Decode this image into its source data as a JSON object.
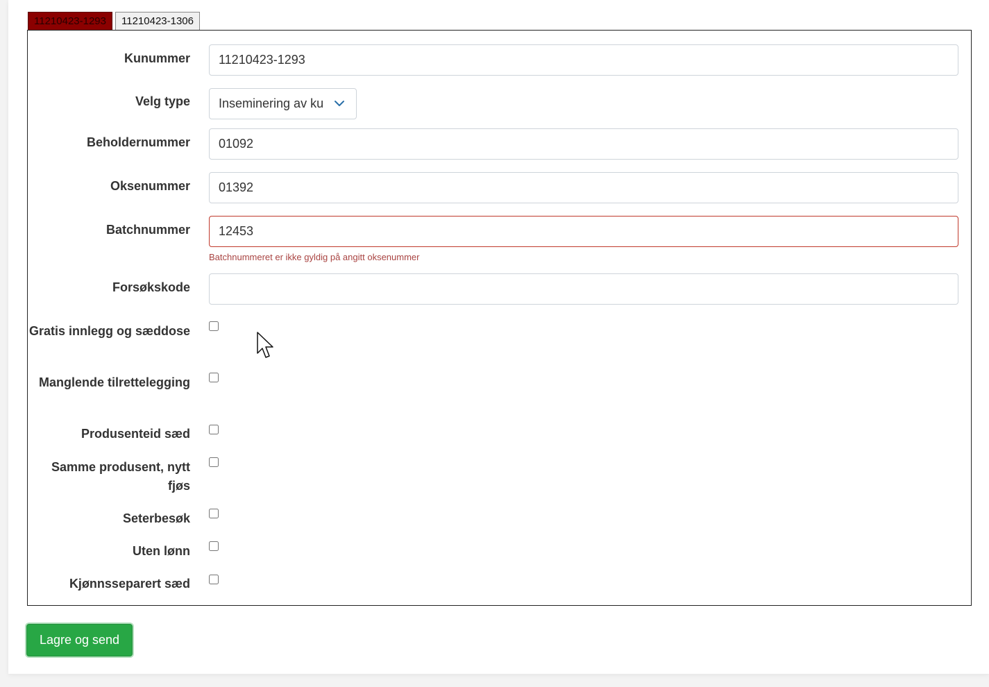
{
  "tabs": [
    {
      "label": "11210423-1293",
      "active": true
    },
    {
      "label": "11210423-1306",
      "active": false
    }
  ],
  "form": {
    "kunummer": {
      "label": "Kunummer",
      "value": "11210423-1293"
    },
    "type": {
      "label": "Velg type",
      "value": "Inseminering av ku",
      "icon": "chevron-down-icon"
    },
    "beholdernummer": {
      "label": "Beholdernummer",
      "value": "01092"
    },
    "oksenummer": {
      "label": "Oksenummer",
      "value": "01392"
    },
    "batchnummer": {
      "label": "Batchnummer",
      "value": "12453",
      "error": "Batchnummeret er ikke gyldig på angitt oksenummer"
    },
    "forsokskode": {
      "label": "Forsøkskode",
      "value": ""
    },
    "checkboxes": [
      {
        "label": "Gratis innlegg og sæddose",
        "checked": false
      },
      {
        "label": "Manglende tilrettelegging",
        "checked": false
      },
      {
        "label": "Produsenteid sæd",
        "checked": false
      },
      {
        "label": "Samme produsent, nytt fjøs",
        "checked": false
      },
      {
        "label": "Seterbesøk",
        "checked": false
      },
      {
        "label": "Uten lønn",
        "checked": false
      },
      {
        "label": "Kjønnsseparert sæd",
        "checked": false
      }
    ]
  },
  "submit_label": "Lagre og send",
  "colors": {
    "error": "#a94442",
    "accent": "#28a745",
    "active_tab": "#8b0000"
  }
}
